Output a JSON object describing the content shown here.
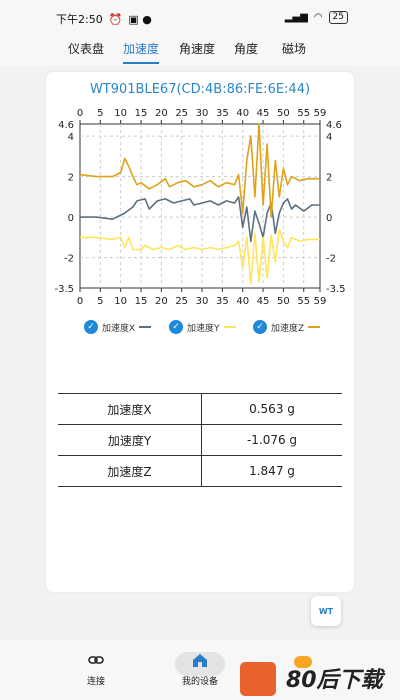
{
  "status": {
    "time": "下午2:50",
    "battery": "25"
  },
  "tabs": [
    {
      "label": "仪表盘",
      "active": false
    },
    {
      "label": "加速度",
      "active": true
    },
    {
      "label": "角速度",
      "active": false
    },
    {
      "label": "角度",
      "active": false
    },
    {
      "label": "磁场",
      "active": false
    }
  ],
  "chart_data": {
    "type": "line",
    "title": "WT901BLE67(CD:4B:86:FE:6E:44)",
    "x_ticks": [
      "0",
      "5",
      "10",
      "15",
      "20",
      "25",
      "30",
      "35",
      "40",
      "45",
      "50",
      "55",
      "59"
    ],
    "xlim": [
      0,
      59
    ],
    "ylim": [
      -3.5,
      4.6
    ],
    "y_ticks": [
      "4.6",
      "4",
      "2",
      "0",
      "-2",
      "-3.5"
    ],
    "grid": true,
    "legend_position": "bottom",
    "series": [
      {
        "name": "加速度X",
        "color": "#5c7180",
        "x": [
          0,
          4,
          8,
          10,
          11,
          13,
          14,
          16,
          17,
          19,
          21,
          23,
          25,
          27,
          28,
          30,
          32,
          34,
          36,
          38,
          39,
          40,
          41,
          42,
          43,
          44,
          45,
          46,
          47,
          48,
          49,
          50,
          51,
          52,
          53,
          55,
          57,
          59
        ],
        "y": [
          0,
          0,
          -0.1,
          0.1,
          0.2,
          0.5,
          0.8,
          0.9,
          0.4,
          0.8,
          0.9,
          0.7,
          0.8,
          0.9,
          0.6,
          0.7,
          0.8,
          0.6,
          0.8,
          0.7,
          1.0,
          -0.5,
          0.5,
          -1.2,
          0.3,
          -0.3,
          -1.0,
          0.2,
          0.7,
          -0.8,
          0.2,
          0.7,
          0.9,
          0.4,
          0.6,
          0.3,
          0.6,
          0.6
        ]
      },
      {
        "name": "加速度Y",
        "color": "#ffe45c",
        "x": [
          0,
          4,
          8,
          10,
          11,
          12,
          13,
          15,
          16,
          18,
          20,
          22,
          24,
          26,
          28,
          30,
          32,
          34,
          36,
          38,
          39,
          40,
          41,
          42,
          43,
          44,
          45,
          46,
          47,
          48,
          49,
          50,
          51,
          52,
          54,
          56,
          59
        ],
        "y": [
          -1,
          -1,
          -1.1,
          -1.0,
          -1.5,
          -1.0,
          -1.6,
          -1.6,
          -1.4,
          -1.6,
          -1.5,
          -1.6,
          -1.4,
          -1.6,
          -1.5,
          -1.6,
          -1.5,
          -1.6,
          -1.5,
          -1.4,
          -1.2,
          -2.5,
          -1.0,
          -3.3,
          -0.8,
          -3.2,
          -1.0,
          -3.0,
          -0.9,
          -2.2,
          -0.6,
          -1.2,
          -1.5,
          -1.0,
          -1.2,
          -1.1,
          -1.1
        ]
      },
      {
        "name": "加速度Z",
        "color": "#e0a21c",
        "x": [
          0,
          4,
          8,
          10,
          11,
          12,
          13,
          14,
          15,
          17,
          19,
          21,
          22,
          24,
          26,
          28,
          30,
          32,
          34,
          36,
          38,
          39,
          40,
          41,
          42,
          43,
          44,
          45,
          46,
          47,
          48,
          49,
          50,
          51,
          52,
          54,
          56,
          59
        ],
        "y": [
          2.1,
          2.0,
          2.0,
          2.2,
          2.9,
          2.5,
          2.0,
          1.6,
          1.7,
          1.4,
          1.6,
          1.9,
          1.5,
          1.7,
          1.8,
          1.5,
          1.6,
          1.8,
          1.5,
          1.7,
          1.6,
          2.1,
          0.2,
          2.8,
          4.0,
          1.0,
          4.6,
          0.6,
          3.6,
          0.0,
          2.8,
          1.0,
          2.4,
          1.6,
          2.0,
          1.8,
          1.9,
          1.9
        ]
      }
    ]
  },
  "table": [
    {
      "label": "加速度X",
      "value": "0.563 g"
    },
    {
      "label": "加速度Y",
      "value": "-1.076 g"
    },
    {
      "label": "加速度Z",
      "value": "1.847 g"
    }
  ],
  "fab_label": "WT",
  "nav": [
    {
      "label": "连接",
      "icon": "link-icon"
    },
    {
      "label": "我的设备",
      "icon": "home-icon"
    }
  ],
  "watermark": {
    "text": "80后下载"
  }
}
